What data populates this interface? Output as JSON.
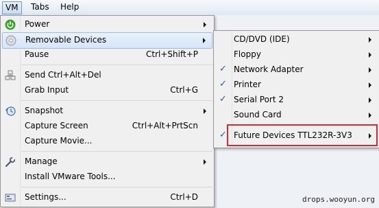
{
  "menubar": {
    "vm": "VM",
    "tabs": "Tabs",
    "help": "Help"
  },
  "main_menu": {
    "power": "Power",
    "removable_devices": "Removable Devices",
    "pause": "Pause",
    "pause_shortcut": "Ctrl+Shift+P",
    "send_cad": "Send Ctrl+Alt+Del",
    "grab_input": "Grab Input",
    "grab_input_shortcut": "Ctrl+G",
    "snapshot": "Snapshot",
    "capture_screen": "Capture Screen",
    "capture_screen_shortcut": "Ctrl+Alt+PrtScn",
    "capture_movie": "Capture Movie...",
    "manage": "Manage",
    "install_tools": "Install VMware Tools...",
    "settings": "Settings...",
    "settings_shortcut": "Ctrl+D"
  },
  "submenu": {
    "cd_dvd": "CD/DVD (IDE)",
    "floppy": "Floppy",
    "network_adapter": "Network Adapter",
    "printer": "Printer",
    "serial_port": "Serial Port 2",
    "sound_card": "Sound Card",
    "future_devices": "Future Devices TTL232R-3V3",
    "check_glyph": "✓"
  },
  "watermark": "drops.wooyun.org",
  "colors": {
    "highlight_border": "#d32c2c",
    "check": "#2357a8"
  }
}
